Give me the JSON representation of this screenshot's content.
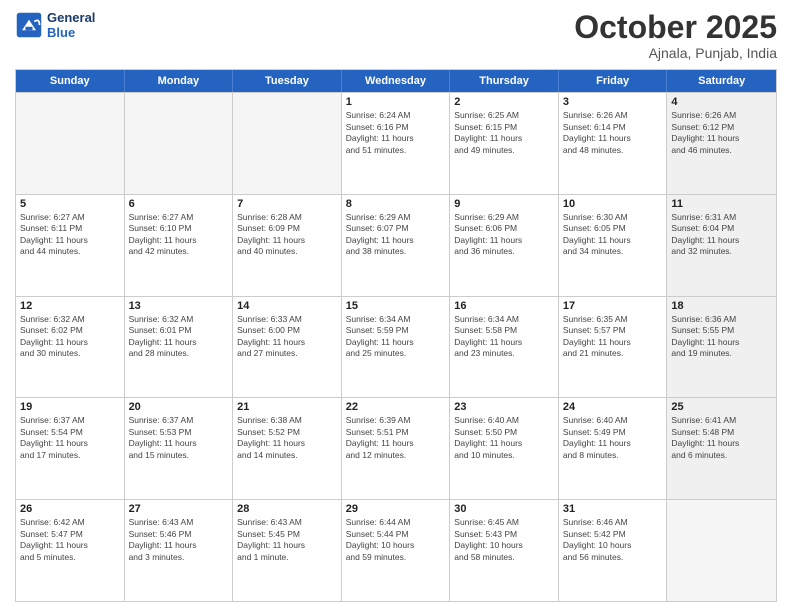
{
  "header": {
    "logo_line1": "General",
    "logo_line2": "Blue",
    "month": "October 2025",
    "location": "Ajnala, Punjab, India"
  },
  "weekdays": [
    "Sunday",
    "Monday",
    "Tuesday",
    "Wednesday",
    "Thursday",
    "Friday",
    "Saturday"
  ],
  "rows": [
    [
      {
        "day": "",
        "info": "",
        "empty": true
      },
      {
        "day": "",
        "info": "",
        "empty": true
      },
      {
        "day": "",
        "info": "",
        "empty": true
      },
      {
        "day": "1",
        "info": "Sunrise: 6:24 AM\nSunset: 6:16 PM\nDaylight: 11 hours\nand 51 minutes.",
        "empty": false
      },
      {
        "day": "2",
        "info": "Sunrise: 6:25 AM\nSunset: 6:15 PM\nDaylight: 11 hours\nand 49 minutes.",
        "empty": false
      },
      {
        "day": "3",
        "info": "Sunrise: 6:26 AM\nSunset: 6:14 PM\nDaylight: 11 hours\nand 48 minutes.",
        "empty": false
      },
      {
        "day": "4",
        "info": "Sunrise: 6:26 AM\nSunset: 6:12 PM\nDaylight: 11 hours\nand 46 minutes.",
        "empty": false,
        "shaded": true
      }
    ],
    [
      {
        "day": "5",
        "info": "Sunrise: 6:27 AM\nSunset: 6:11 PM\nDaylight: 11 hours\nand 44 minutes.",
        "empty": false
      },
      {
        "day": "6",
        "info": "Sunrise: 6:27 AM\nSunset: 6:10 PM\nDaylight: 11 hours\nand 42 minutes.",
        "empty": false
      },
      {
        "day": "7",
        "info": "Sunrise: 6:28 AM\nSunset: 6:09 PM\nDaylight: 11 hours\nand 40 minutes.",
        "empty": false
      },
      {
        "day": "8",
        "info": "Sunrise: 6:29 AM\nSunset: 6:07 PM\nDaylight: 11 hours\nand 38 minutes.",
        "empty": false
      },
      {
        "day": "9",
        "info": "Sunrise: 6:29 AM\nSunset: 6:06 PM\nDaylight: 11 hours\nand 36 minutes.",
        "empty": false
      },
      {
        "day": "10",
        "info": "Sunrise: 6:30 AM\nSunset: 6:05 PM\nDaylight: 11 hours\nand 34 minutes.",
        "empty": false
      },
      {
        "day": "11",
        "info": "Sunrise: 6:31 AM\nSunset: 6:04 PM\nDaylight: 11 hours\nand 32 minutes.",
        "empty": false,
        "shaded": true
      }
    ],
    [
      {
        "day": "12",
        "info": "Sunrise: 6:32 AM\nSunset: 6:02 PM\nDaylight: 11 hours\nand 30 minutes.",
        "empty": false
      },
      {
        "day": "13",
        "info": "Sunrise: 6:32 AM\nSunset: 6:01 PM\nDaylight: 11 hours\nand 28 minutes.",
        "empty": false
      },
      {
        "day": "14",
        "info": "Sunrise: 6:33 AM\nSunset: 6:00 PM\nDaylight: 11 hours\nand 27 minutes.",
        "empty": false
      },
      {
        "day": "15",
        "info": "Sunrise: 6:34 AM\nSunset: 5:59 PM\nDaylight: 11 hours\nand 25 minutes.",
        "empty": false
      },
      {
        "day": "16",
        "info": "Sunrise: 6:34 AM\nSunset: 5:58 PM\nDaylight: 11 hours\nand 23 minutes.",
        "empty": false
      },
      {
        "day": "17",
        "info": "Sunrise: 6:35 AM\nSunset: 5:57 PM\nDaylight: 11 hours\nand 21 minutes.",
        "empty": false
      },
      {
        "day": "18",
        "info": "Sunrise: 6:36 AM\nSunset: 5:55 PM\nDaylight: 11 hours\nand 19 minutes.",
        "empty": false,
        "shaded": true
      }
    ],
    [
      {
        "day": "19",
        "info": "Sunrise: 6:37 AM\nSunset: 5:54 PM\nDaylight: 11 hours\nand 17 minutes.",
        "empty": false
      },
      {
        "day": "20",
        "info": "Sunrise: 6:37 AM\nSunset: 5:53 PM\nDaylight: 11 hours\nand 15 minutes.",
        "empty": false
      },
      {
        "day": "21",
        "info": "Sunrise: 6:38 AM\nSunset: 5:52 PM\nDaylight: 11 hours\nand 14 minutes.",
        "empty": false
      },
      {
        "day": "22",
        "info": "Sunrise: 6:39 AM\nSunset: 5:51 PM\nDaylight: 11 hours\nand 12 minutes.",
        "empty": false
      },
      {
        "day": "23",
        "info": "Sunrise: 6:40 AM\nSunset: 5:50 PM\nDaylight: 11 hours\nand 10 minutes.",
        "empty": false
      },
      {
        "day": "24",
        "info": "Sunrise: 6:40 AM\nSunset: 5:49 PM\nDaylight: 11 hours\nand 8 minutes.",
        "empty": false
      },
      {
        "day": "25",
        "info": "Sunrise: 6:41 AM\nSunset: 5:48 PM\nDaylight: 11 hours\nand 6 minutes.",
        "empty": false,
        "shaded": true
      }
    ],
    [
      {
        "day": "26",
        "info": "Sunrise: 6:42 AM\nSunset: 5:47 PM\nDaylight: 11 hours\nand 5 minutes.",
        "empty": false
      },
      {
        "day": "27",
        "info": "Sunrise: 6:43 AM\nSunset: 5:46 PM\nDaylight: 11 hours\nand 3 minutes.",
        "empty": false
      },
      {
        "day": "28",
        "info": "Sunrise: 6:43 AM\nSunset: 5:45 PM\nDaylight: 11 hours\nand 1 minute.",
        "empty": false
      },
      {
        "day": "29",
        "info": "Sunrise: 6:44 AM\nSunset: 5:44 PM\nDaylight: 10 hours\nand 59 minutes.",
        "empty": false
      },
      {
        "day": "30",
        "info": "Sunrise: 6:45 AM\nSunset: 5:43 PM\nDaylight: 10 hours\nand 58 minutes.",
        "empty": false
      },
      {
        "day": "31",
        "info": "Sunrise: 6:46 AM\nSunset: 5:42 PM\nDaylight: 10 hours\nand 56 minutes.",
        "empty": false
      },
      {
        "day": "",
        "info": "",
        "empty": true,
        "shaded": true
      }
    ]
  ]
}
